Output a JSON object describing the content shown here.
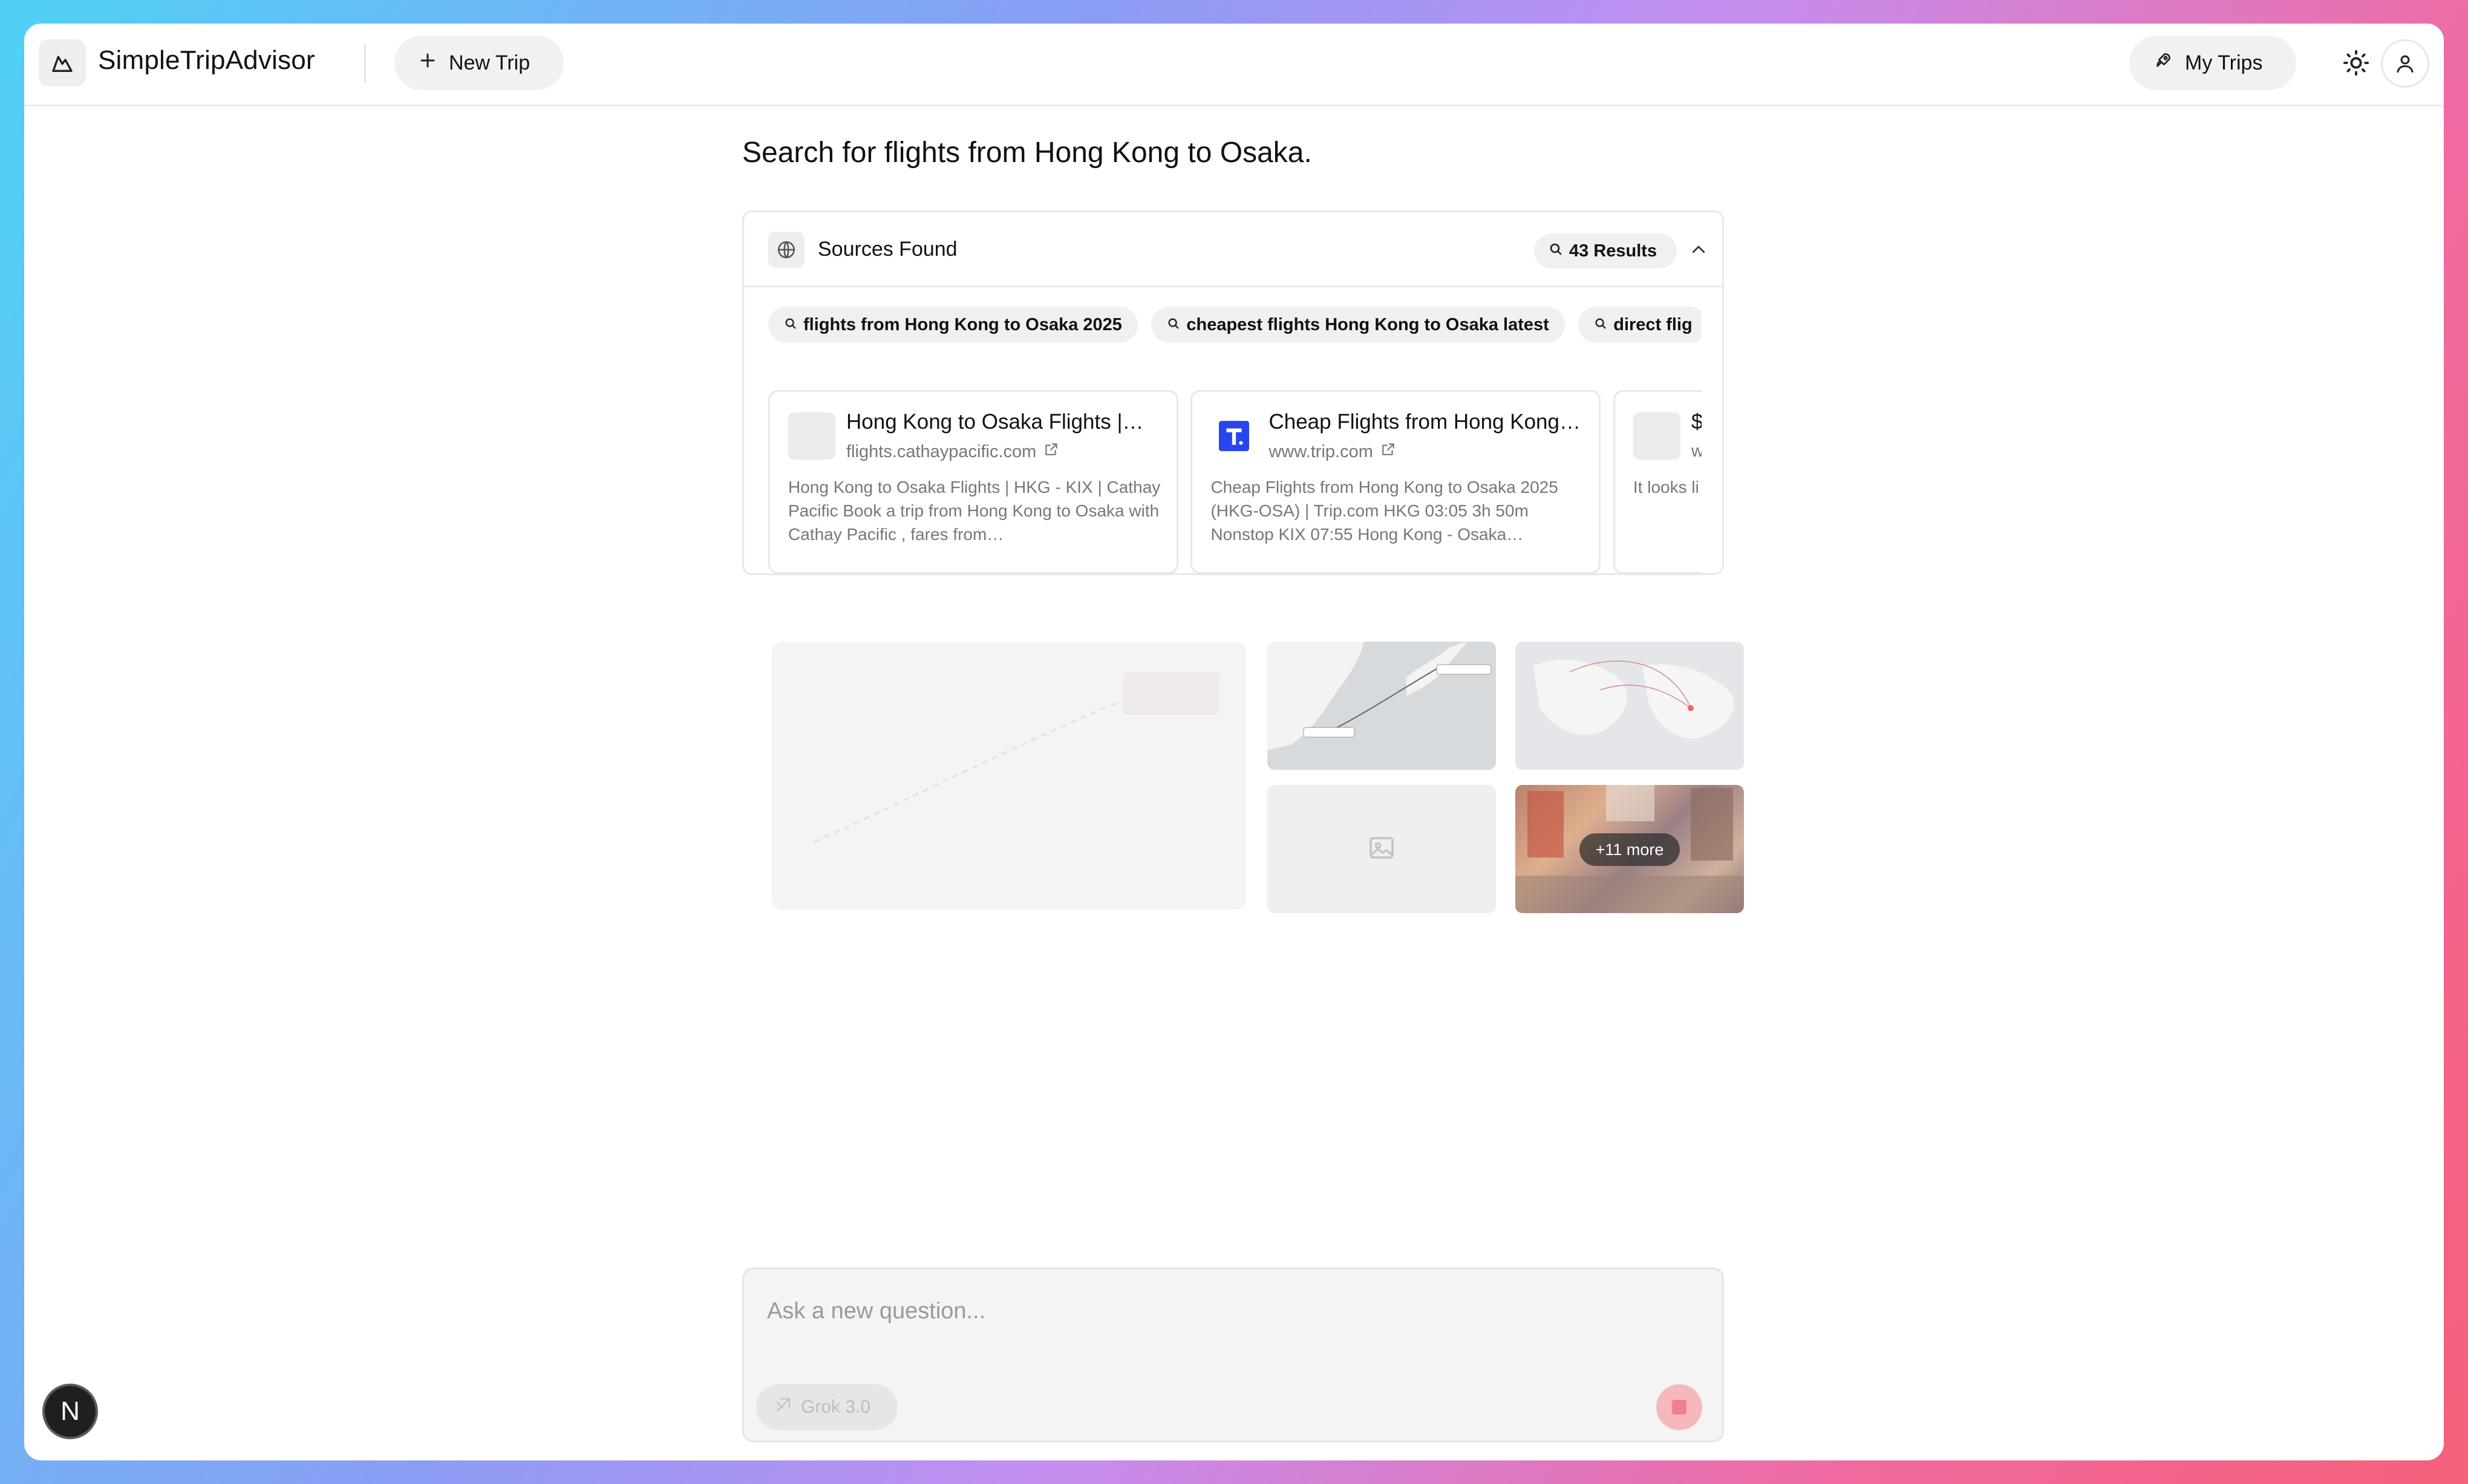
{
  "header": {
    "brand": "SimpleTripAdvisor",
    "new_trip_label": "New Trip",
    "my_trips_label": "My Trips",
    "icons": [
      "mountain-logo-icon",
      "plus-icon",
      "rocket-icon",
      "sun-icon",
      "user-icon"
    ]
  },
  "main": {
    "query": "Search for flights from Hong Kong to Osaka."
  },
  "sources": {
    "title": "Sources Found",
    "results_label": "43 Results",
    "queries": [
      "flights from Hong Kong to Osaka 2025",
      "cheapest flights Hong Kong to Osaka latest",
      "direct flig"
    ],
    "cards": [
      {
        "title": "Hong Kong to Osaka Flights |…",
        "domain": "flights.cathaypacific.com",
        "snippet": "Hong Kong to Osaka Flights | HKG - KIX | Cathay Pacific Book a trip from Hong Kong to Osaka with Cathay Pacific , fares from…"
      },
      {
        "title": "Cheap Flights from Hong Kong…",
        "domain": "www.trip.com",
        "snippet": "Cheap Flights from Hong Kong to Osaka 2025 (HKG-OSA) | Trip.com HKG 03:05 3h 50m Nonstop KIX 07:55 Hong Kong - Osaka…"
      },
      {
        "title": "$",
        "domain": "w",
        "snippet": "It looks li are curre May. fror"
      }
    ]
  },
  "images": {
    "more_label": "+11 more"
  },
  "ask": {
    "placeholder": "Ask a new question...",
    "model_label": "Grok 3.0"
  },
  "dev_badge": "N"
}
